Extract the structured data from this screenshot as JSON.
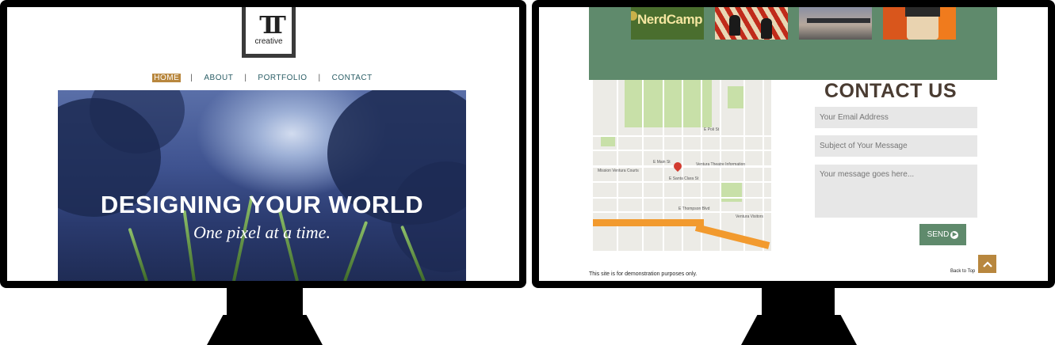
{
  "left_site": {
    "logo": {
      "mark": "TT",
      "word": "creative"
    },
    "nav": {
      "items": [
        {
          "label": "HOME",
          "active": true
        },
        {
          "label": "ABOUT",
          "active": false
        },
        {
          "label": "PORTFOLIO",
          "active": false
        },
        {
          "label": "CONTACT",
          "active": false
        }
      ],
      "separator": "|"
    },
    "hero": {
      "title": "DESIGNING YOUR WORLD",
      "subtitle": "One pixel at a time."
    }
  },
  "right_site": {
    "portfolio_thumbs": [
      {
        "name": "nerdcamp-thumb",
        "text": "NerdCamp"
      },
      {
        "name": "poster-thumb"
      },
      {
        "name": "bridge-thumb"
      },
      {
        "name": "portrait-thumb"
      }
    ],
    "map": {
      "labels": [
        "E Main St",
        "E Santa Clara St",
        "E Thompson Blvd",
        "Ventura Visitors",
        "Mission Ventura Courts",
        "E Poli St",
        "Ventura Theatre Information"
      ]
    },
    "contact": {
      "title": "CONTACT US",
      "email_placeholder": "Your Email Address",
      "subject_placeholder": "Subject of Your Message",
      "message_placeholder": "Your message goes here...",
      "send_label": "SEND"
    },
    "footer": {
      "note": "This site is for demonstration purposes only.",
      "back_to_top": "Back to Top"
    }
  },
  "colors": {
    "accent_gold": "#b8873e",
    "accent_green": "#5f8a6c",
    "nav_teal": "#2b5e66",
    "title_brown": "#4a3c32"
  }
}
